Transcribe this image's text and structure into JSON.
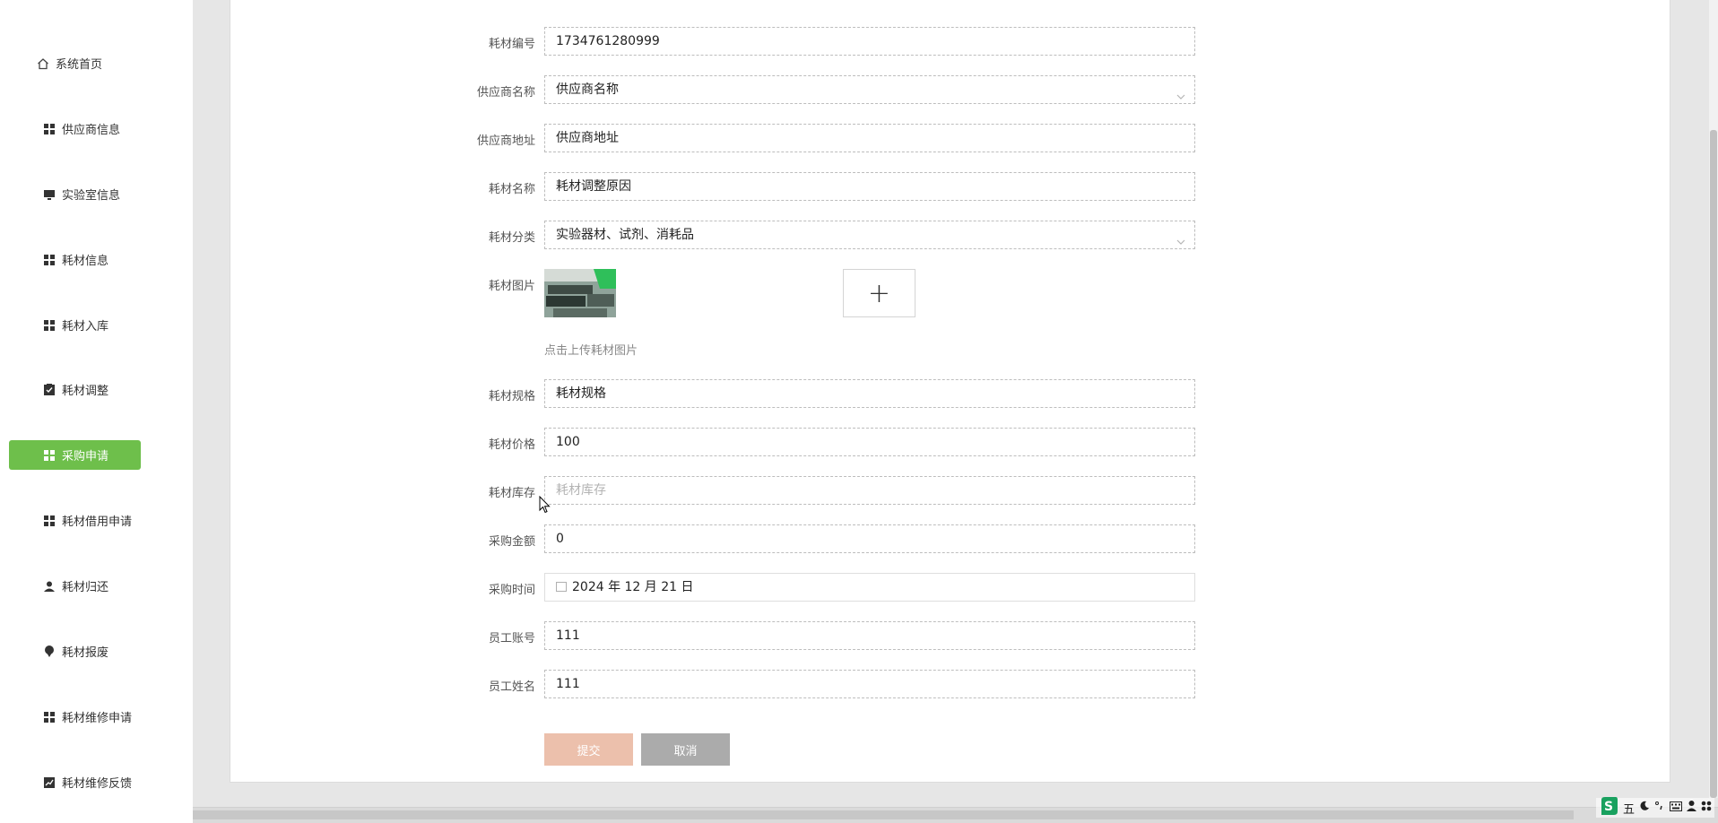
{
  "sidebar": {
    "items": [
      {
        "label": "系统首页",
        "icon": "home-icon"
      },
      {
        "label": "供应商信息",
        "icon": "grid-icon"
      },
      {
        "label": "实验室信息",
        "icon": "monitor-icon"
      },
      {
        "label": "耗材信息",
        "icon": "grid-icon"
      },
      {
        "label": "耗材入库",
        "icon": "grid-icon"
      },
      {
        "label": "耗材调整",
        "icon": "clipboard-icon"
      },
      {
        "label": "采购申请",
        "icon": "grid-icon",
        "active": true
      },
      {
        "label": "耗材借用申请",
        "icon": "grid-icon"
      },
      {
        "label": "耗材归还",
        "icon": "user-icon"
      },
      {
        "label": "耗材报废",
        "icon": "pin-icon"
      },
      {
        "label": "耗材维修申请",
        "icon": "grid-icon"
      },
      {
        "label": "耗材维修反馈",
        "icon": "chart-icon"
      }
    ]
  },
  "form": {
    "material_code": {
      "label": "耗材编号",
      "value": "1734761280999"
    },
    "supplier_name": {
      "label": "供应商名称",
      "value": "供应商名称"
    },
    "supplier_address": {
      "label": "供应商地址",
      "value": "供应商地址"
    },
    "material_name": {
      "label": "耗材名称",
      "value": "耗材调整原因"
    },
    "material_category": {
      "label": "耗材分类",
      "value": "实验器材、试剂、消耗品"
    },
    "material_image": {
      "label": "耗材图片",
      "plus": "+",
      "hint": "点击上传耗材图片"
    },
    "material_spec": {
      "label": "耗材规格",
      "value": "耗材规格"
    },
    "material_price": {
      "label": "耗材价格",
      "value": "100"
    },
    "material_stock": {
      "label": "耗材库存",
      "placeholder": "耗材库存"
    },
    "purchase_amount": {
      "label": "采购金额",
      "value": "0"
    },
    "purchase_time": {
      "label": "采购时间",
      "value": "2024 年 12 月 21 日"
    },
    "employee_account": {
      "label": "员工账号",
      "value": "111"
    },
    "employee_name": {
      "label": "员工姓名",
      "value": "111"
    }
  },
  "buttons": {
    "submit": "提交",
    "cancel": "取消"
  },
  "ime_toolbar": {
    "mode": "五"
  },
  "colors": {
    "accent": "#6ebf4b",
    "submit": "#ecc0ac",
    "cancel": "#ababab"
  }
}
